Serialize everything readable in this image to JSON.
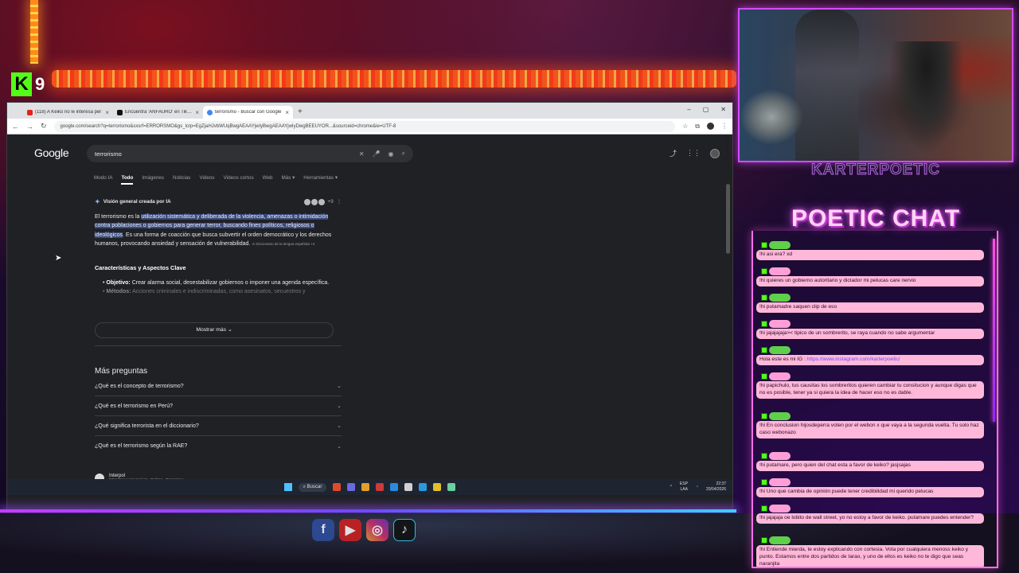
{
  "overlay": {
    "kick_channel_number": "9",
    "brand_name": "KARTERPOETIC",
    "chat_title": "POETIC CHAT"
  },
  "browser": {
    "tabs": [
      {
        "title": "(118) A Keiko no le interesa per",
        "favicon_color": "#e62117"
      },
      {
        "title": "Encuentra 'ANFAURO' en TikTok",
        "favicon_color": "#111111"
      },
      {
        "title": "terrorismo - Buscar con Google",
        "favicon_color": "#4285f4"
      }
    ],
    "url": "google.com/search?q=terrorismo&sxsrf=ERRORSMO&gs_lcrp=EgZjaHJvbWUqBwgAEAAYjwIyBwgAEAAYjwIyDwgBEEUYOR...&sourceid=chrome&ie=UTF-8",
    "google_logo": "Google",
    "search_query": "terrorismo",
    "search_tabs": [
      "Modo IA",
      "Todo",
      "Imágenes",
      "Noticias",
      "Videos",
      "Videos cortos",
      "Web",
      "Más ▾",
      "Herramientas ▾"
    ],
    "active_search_tab": "Todo",
    "ai_overview": {
      "heading": "Visión general creada por IA",
      "source_count": "+9",
      "intro_before": "El terrorismo es la ",
      "intro_highlight": "utilización sistemática y deliberada de la violencia, amenazas o intimidación contra poblaciones o gobiernos para generar terror, buscando fines políticos, religiosos o ideológicos",
      "intro_after": ". Es una forma de coacción que busca subvertir el orden democrático y los derechos humanos, provocando ansiedad y sensación de vulnerabilidad.",
      "citation": "Diccionario de la lengua española +4",
      "subheading": "Características y Aspectos Clave",
      "bullet1_label": "Objetivo:",
      "bullet1_text": " Crear alarma social, desestabilizar gobiernos o imponer una agenda específica.",
      "bullet2_label": "Métodos:",
      "bullet2_text": " Acciones criminales e indiscriminadas, como asesinatos, secuestros y",
      "show_more": "Mostrar más"
    },
    "people_also_ask": {
      "title": "Más preguntas",
      "questions": [
        "¿Qué es el concepto de terrorismo?",
        "¿Qué es el terrorismo en Perú?",
        "¿Qué significa terrorista en el diccionario?",
        "¿Qué es el terrorismo según la RAE?"
      ]
    },
    "first_result": {
      "site_name": "Interpol",
      "breadcrumb": "https://www.interpol.int › Delitos › Terrorismo"
    }
  },
  "taskbar": {
    "search_label": "Buscar",
    "language_top": "ESP",
    "language_bottom": "LAA",
    "time": "22:37",
    "date": "20/04/2026"
  },
  "chat": {
    "messages": [
      {
        "text": "!hi asi era? xd",
        "user_style": "green"
      },
      {
        "text": "!hi quieres un gobierno autoritario y dictador mi pelucas care nervio",
        "user_style": "pink"
      },
      {
        "text": "!hi putamadre saquen clip de eso",
        "user_style": "green"
      },
      {
        "text": "!hi jajajajaja>< tipico de un sombrerito, se raya cuando no sabe argumentar",
        "user_style": "pink"
      },
      {
        "text": "Hola este es mi IG : ",
        "link": "https://www.instagram.com/karterpoetic/",
        "user_style": "green"
      },
      {
        "text": "!hi papichulo, tus causitas los sombreritos quieren cambiar tu consitucion y aunque digas que no es posible, tener ya si quiera la idea de hacer eso no es dable.",
        "user_style": "pink"
      },
      {
        "text": "!hi En conclusion hijosdeperra voten por el webon x que vaya a la segunda vuelta. Tu solo haz caso webonazo",
        "user_style": "green"
      },
      {
        "text": "!hi putamare, pero quien del chat esta a favor de keiko? jasjsajas",
        "user_style": "pink"
      },
      {
        "text": "!hi Uno que cambia de opinión puede tener credibilidad mi querido pelucas",
        "user_style": "pink"
      },
      {
        "text": "!hi jajajaja oe lobito de wall street, yo no estoy a favor de keiko. putamare puedes entender?",
        "user_style": "pink"
      },
      {
        "text": "!hi Entiende mierda, te estoy explicando con cortesia. Vota por cualquiera menoss keiko y punto. Estamos entre dos partidos de tarao, y uno de ellos es keiko no te digo que seas naranjita",
        "user_style": "green"
      }
    ]
  },
  "colors": {
    "accent_pink": "#ff6fe8",
    "kick_green": "#53fc18",
    "chat_bubble": "#ffb8d9",
    "google_bg": "#202124"
  }
}
